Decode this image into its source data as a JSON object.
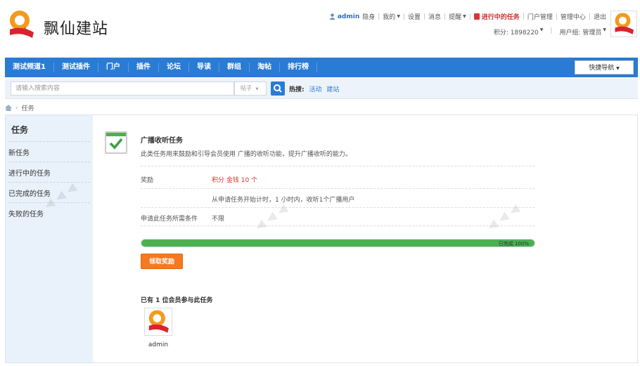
{
  "brand": {
    "name": "飘仙建站"
  },
  "colors": {
    "accent": "#2a7bd4",
    "orange": "#f47920",
    "progress": "#4caf50",
    "sidebar_bg": "#e9f1fa"
  },
  "toplinks": {
    "username": "admin",
    "invisible": "隐身",
    "mine": "我的",
    "settings": "设置",
    "messages": "消息",
    "remind": "提醒",
    "ongoing_tasks": "进行中的任务",
    "portal_manage": "门户管理",
    "admin_center": "管理中心",
    "logout": "退出"
  },
  "subinfo": {
    "credits": "积分: 1898220",
    "usergroup": "用户组: 管理员"
  },
  "nav": {
    "items": [
      "测试频道1",
      "测试插件",
      "门户",
      "插件",
      "论坛",
      "导读",
      "群组",
      "淘帖",
      "排行榜"
    ],
    "quick": "快捷导航"
  },
  "search": {
    "placeholder": "请输入搜索内容",
    "type": "帖子",
    "hot_label": "热搜:",
    "hot_items": [
      "活动",
      "建站"
    ]
  },
  "breadcrumb": {
    "current": "任务"
  },
  "sidebar": {
    "title": "任务",
    "items": [
      "新任务",
      "进行中的任务",
      "已完成的任务",
      "失败的任务"
    ]
  },
  "task": {
    "title": "广播收听任务",
    "desc": "此类任务用来鼓励和引导会员使用 广播的收听功能，提升广播收听的能力。",
    "reward_label": "奖励",
    "reward_value": "积分 金钱 10 个",
    "condition_text": "从申请任务开始计时，1 小时内，收听1个广播用户",
    "requirement_label": "申请此任务所需条件",
    "requirement_value": "不限",
    "progress_pct": 100,
    "progress_label": "已完成 100%",
    "claim_button": "领取奖励",
    "members_title": "已有 1 位会员参与此任务",
    "member_name": "admin"
  }
}
